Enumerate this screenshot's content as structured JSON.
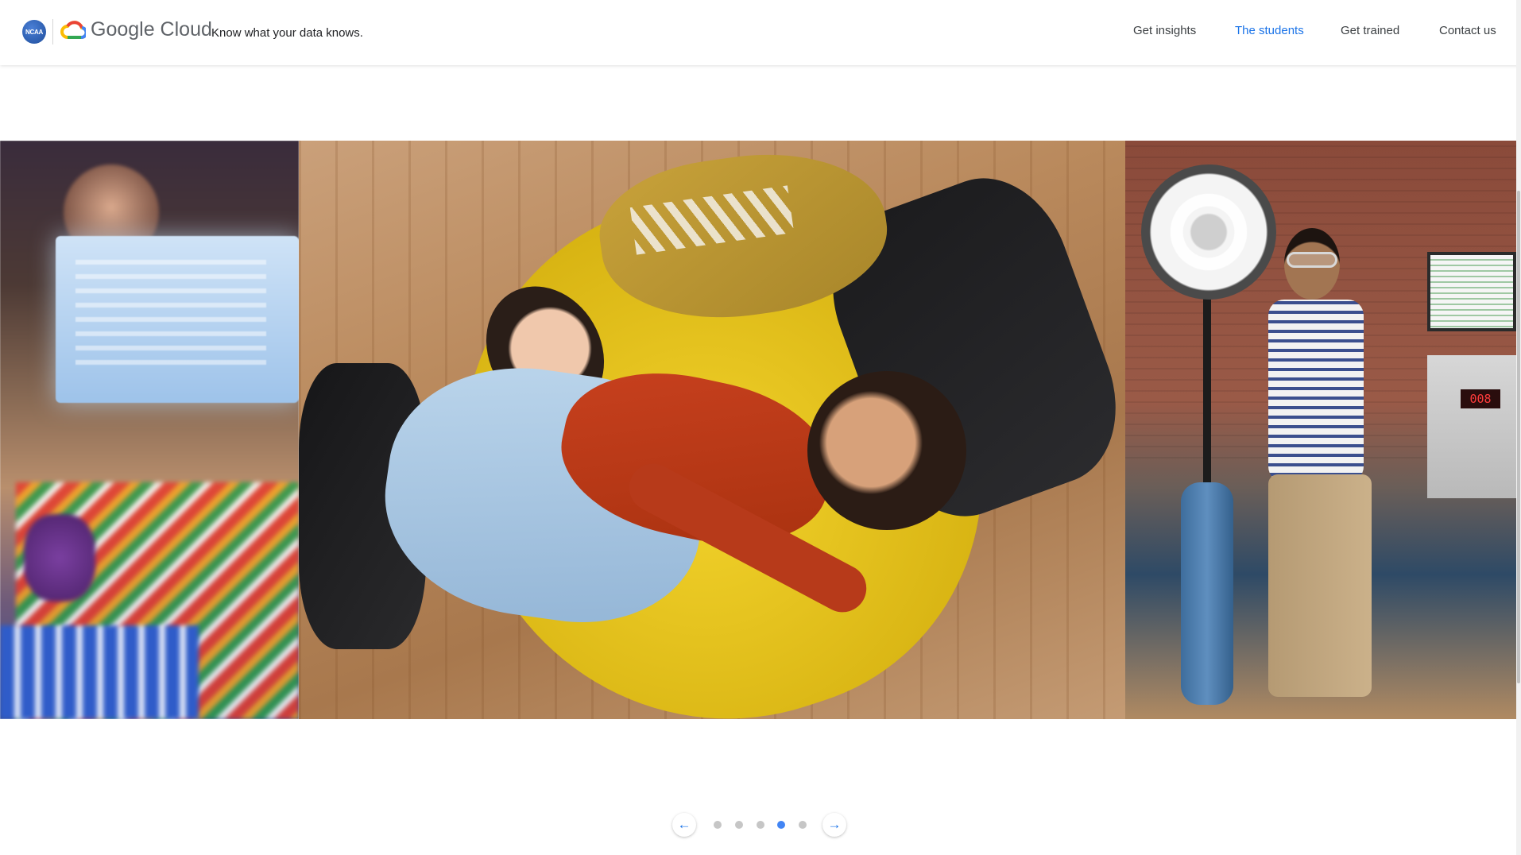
{
  "header": {
    "ncaa_logo_text": "NCAA",
    "brand_name": "Google Cloud",
    "tagline": "Know what your data knows.",
    "nav": [
      {
        "label": "Get insights",
        "active": false
      },
      {
        "label": "The students",
        "active": true
      },
      {
        "label": "Get trained",
        "active": false
      },
      {
        "label": "Contact us",
        "active": false
      }
    ]
  },
  "carousel": {
    "current_slide": 4,
    "total_slides": 5,
    "prev_icon": "arrow-left-icon",
    "next_icon": "arrow-right-icon",
    "prev_glyph": "←",
    "next_glyph": "→",
    "slides": [
      {
        "name": "blurred-office-knitting-photo"
      },
      {
        "name": "students-on-beanbag-photo"
      },
      {
        "name": "student-with-lab-equipment-photo"
      }
    ],
    "equipment_display_text": "008"
  },
  "colors": {
    "accent": "#1a73e8",
    "active_dot": "#4285f4",
    "inactive_dot": "#c6c6c6",
    "nav_text": "#3c4043"
  }
}
